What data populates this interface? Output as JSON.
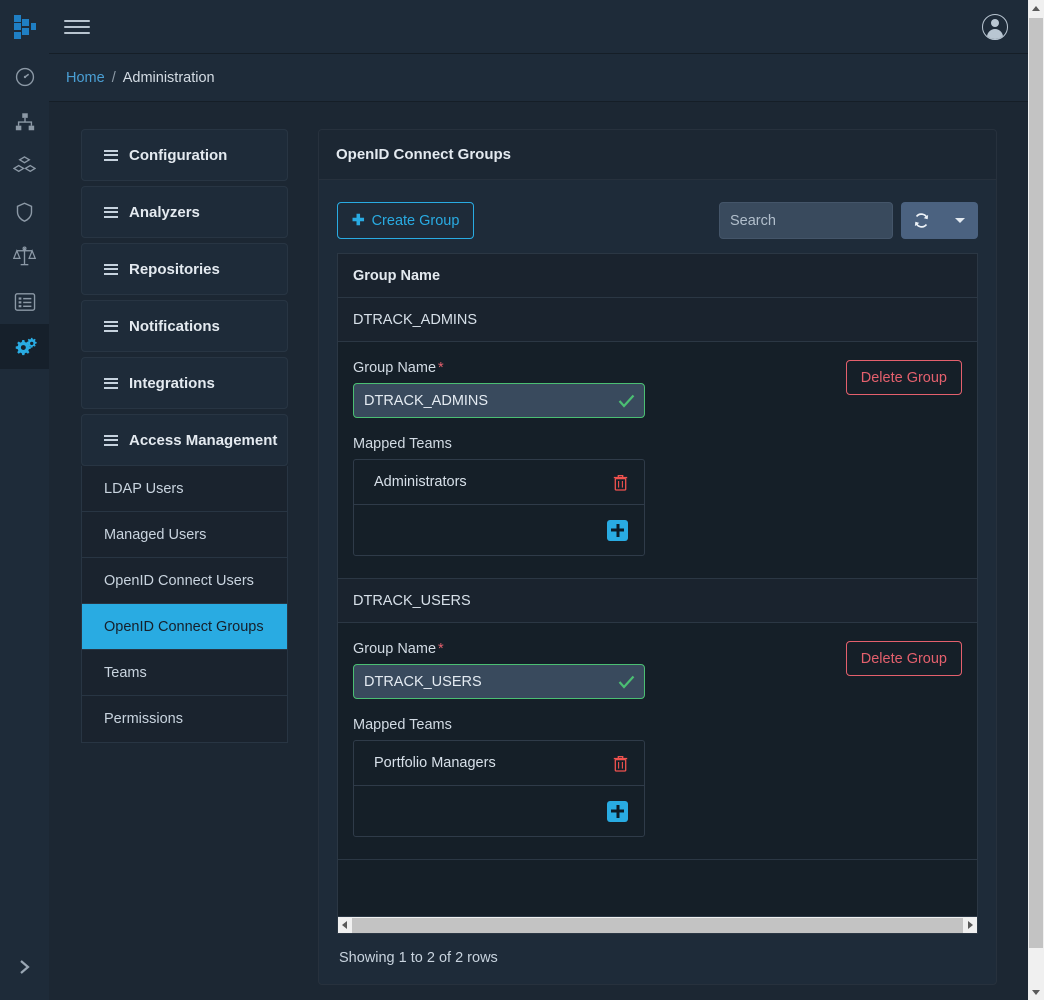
{
  "app": {
    "logo_name": "dependency-track-logo",
    "menu_toggle": "hamburger-menu",
    "user_avatar": "user-avatar"
  },
  "breadcrumb": {
    "home": "Home",
    "separator": "/",
    "current": "Administration"
  },
  "rail": {
    "items": [
      {
        "name": "dashboard",
        "icon": "speedometer-icon",
        "active": false
      },
      {
        "name": "projects",
        "icon": "sitemap-icon",
        "active": false
      },
      {
        "name": "components",
        "icon": "cubes-icon",
        "active": false
      },
      {
        "name": "vulnerabilities",
        "icon": "shield-icon",
        "active": false
      },
      {
        "name": "licenses",
        "icon": "scales-icon",
        "active": false
      },
      {
        "name": "policy-management",
        "icon": "list-alt-icon",
        "active": false
      },
      {
        "name": "administration",
        "icon": "gears-icon",
        "active": true
      }
    ],
    "expand_icon": "chevron-right-icon"
  },
  "adminnav": {
    "sections": [
      {
        "label": "Configuration",
        "icon": "bars-icon"
      },
      {
        "label": "Analyzers",
        "icon": "bars-icon"
      },
      {
        "label": "Repositories",
        "icon": "bars-icon"
      },
      {
        "label": "Notifications",
        "icon": "bars-icon"
      },
      {
        "label": "Integrations",
        "icon": "bars-icon"
      },
      {
        "label": "Access Management",
        "icon": "bars-icon"
      }
    ],
    "subitems": [
      {
        "label": "LDAP Users",
        "active": false
      },
      {
        "label": "Managed Users",
        "active": false
      },
      {
        "label": "OpenID Connect Users",
        "active": false
      },
      {
        "label": "OpenID Connect Groups",
        "active": true
      },
      {
        "label": "Teams",
        "active": false
      },
      {
        "label": "Permissions",
        "active": false
      }
    ]
  },
  "panel": {
    "title": "OpenID Connect Groups",
    "create_button": "Create Group",
    "create_icon": "plus-icon",
    "search_placeholder": "Search",
    "search_value": "",
    "refresh_icon": "refresh-icon",
    "refresh_caret_icon": "caret-down-icon",
    "table_header": "Group Name",
    "footer_text": "Showing 1 to 2 of 2 rows"
  },
  "groups": [
    {
      "name": "DTRACK_ADMINS",
      "detail": {
        "field_label": "Group Name",
        "required_mark": "*",
        "field_value": "DTRACK_ADMINS",
        "valid_icon": "check-icon",
        "delete_button": "Delete Group",
        "teams_label": "Mapped Teams",
        "teams": [
          {
            "name": "Administrators",
            "delete_icon": "trash-icon"
          }
        ],
        "add_icon": "plus-square-icon"
      }
    },
    {
      "name": "DTRACK_USERS",
      "detail": {
        "field_label": "Group Name",
        "required_mark": "*",
        "field_value": "DTRACK_USERS",
        "valid_icon": "check-icon",
        "delete_button": "Delete Group",
        "teams_label": "Mapped Teams",
        "teams": [
          {
            "name": "Portfolio Managers",
            "delete_icon": "trash-icon"
          }
        ],
        "add_icon": "plus-square-icon"
      }
    }
  ],
  "colors": {
    "accent_blue": "#29abe2",
    "link_blue": "#4a9fd4",
    "danger_red": "#e4606d",
    "success_green": "#4bbf73",
    "nav_bg": "#1e2b39",
    "page_bg": "#1c2733",
    "table_bg": "#151f28"
  }
}
